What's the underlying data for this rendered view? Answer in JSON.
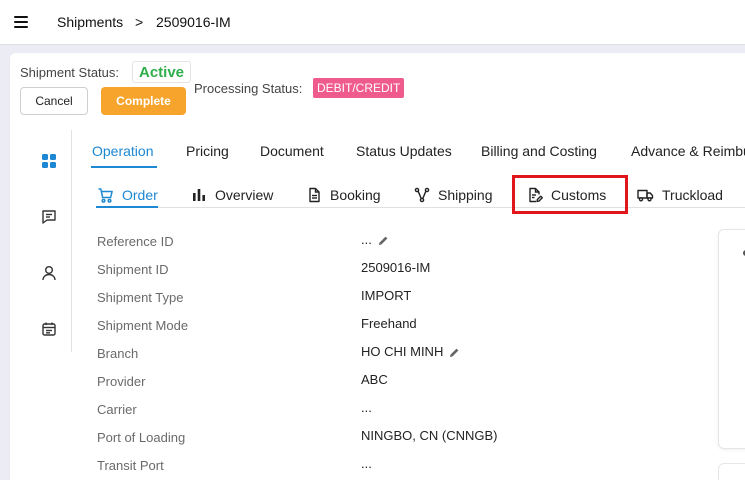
{
  "breadcrumb": {
    "root": "Shipments",
    "separator": ">",
    "current": "2509016-IM"
  },
  "header": {
    "shipment_status_label": "Shipment Status:",
    "shipment_status_value": "Active",
    "processing_status_label": "Processing Status:",
    "processing_status_value": "DEBIT/CREDIT",
    "cancel_label": "Cancel",
    "complete_label": "Complete"
  },
  "colors": {
    "accent": "#1e88d3",
    "active_status": "#2fae4a",
    "processing_badge": "#ef5b8c",
    "complete_button": "#f7a42c",
    "highlight": "#e0161a"
  },
  "rail": [
    {
      "icon": "dashboard-grid-icon",
      "active": true
    },
    {
      "icon": "chat-icon"
    },
    {
      "icon": "user-icon"
    },
    {
      "icon": "calendar-icon"
    }
  ],
  "tabs": [
    {
      "label": "Operation",
      "active": true
    },
    {
      "label": "Pricing"
    },
    {
      "label": "Document"
    },
    {
      "label": "Status Updates"
    },
    {
      "label": "Billing and Costing"
    },
    {
      "label": "Advance & Reimbu"
    }
  ],
  "subtabs": [
    {
      "label": "Order",
      "icon": "cart-icon",
      "active": true
    },
    {
      "label": "Overview",
      "icon": "bar-chart-icon"
    },
    {
      "label": "Booking",
      "icon": "document-icon"
    },
    {
      "label": "Shipping",
      "icon": "route-icon"
    },
    {
      "label": "Customs",
      "icon": "edit-document-icon",
      "highlighted": true
    },
    {
      "label": "Truckload",
      "icon": "truck-icon"
    }
  ],
  "fields": [
    {
      "label": "Reference ID",
      "value": "...",
      "editable": true
    },
    {
      "label": "Shipment ID",
      "value": "2509016-IM"
    },
    {
      "label": "Shipment Type",
      "value": "IMPORT"
    },
    {
      "label": "Shipment Mode",
      "value": "Freehand"
    },
    {
      "label": "Branch",
      "value": "HO CHI MINH",
      "editable": true
    },
    {
      "label": "Provider",
      "value": "ABC"
    },
    {
      "label": "Carrier",
      "value": "..."
    },
    {
      "label": "Port of Loading",
      "value": "NINGBO, CN (CNNGB)"
    },
    {
      "label": "Transit Port",
      "value": "..."
    }
  ]
}
